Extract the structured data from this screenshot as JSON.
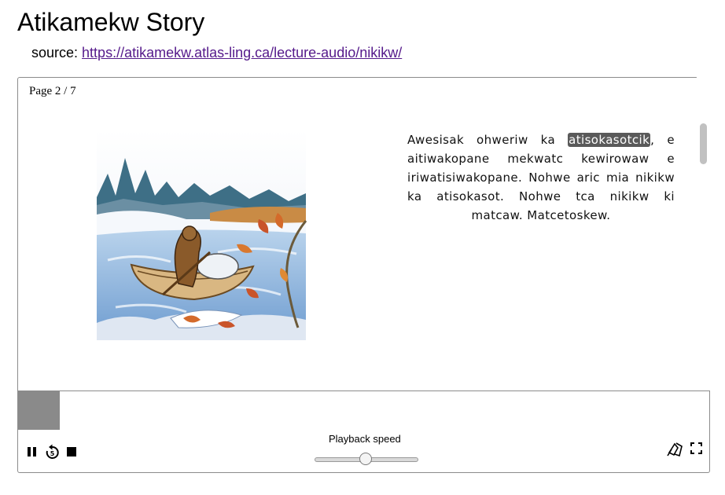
{
  "title": "Atikamekw Story",
  "source": {
    "prefix": "source:",
    "link_text": "https://atikamekw.atlas-ling.ca/lecture-audio/nikikw/"
  },
  "reader": {
    "page_label": "Page 2 / 7",
    "text_before": "Awesisak ohweriw ka ",
    "highlighted_word": "atisokasotcik",
    "text_after": ", e aitiwakopane mekwatc kewirowaw e iriwatisiwakopane. Nohwe aric mia nikikw ka atisokasot. Nohwe tca nikikw ki matcaw. Matcetoskew."
  },
  "audio": {
    "progress_fraction": 0.06,
    "playback_speed_label": "Playback speed",
    "speed_fraction": 0.5
  },
  "icons": {
    "pause": "pause-icon",
    "replay": "replay-5-icon",
    "stop": "stop-icon",
    "theme": "theme-toggle-icon",
    "fullscreen": "fullscreen-icon"
  },
  "colors": {
    "highlight_bg": "#5a5a5a",
    "progress_fill": "#8a8a8a",
    "link": "#551a8b"
  }
}
